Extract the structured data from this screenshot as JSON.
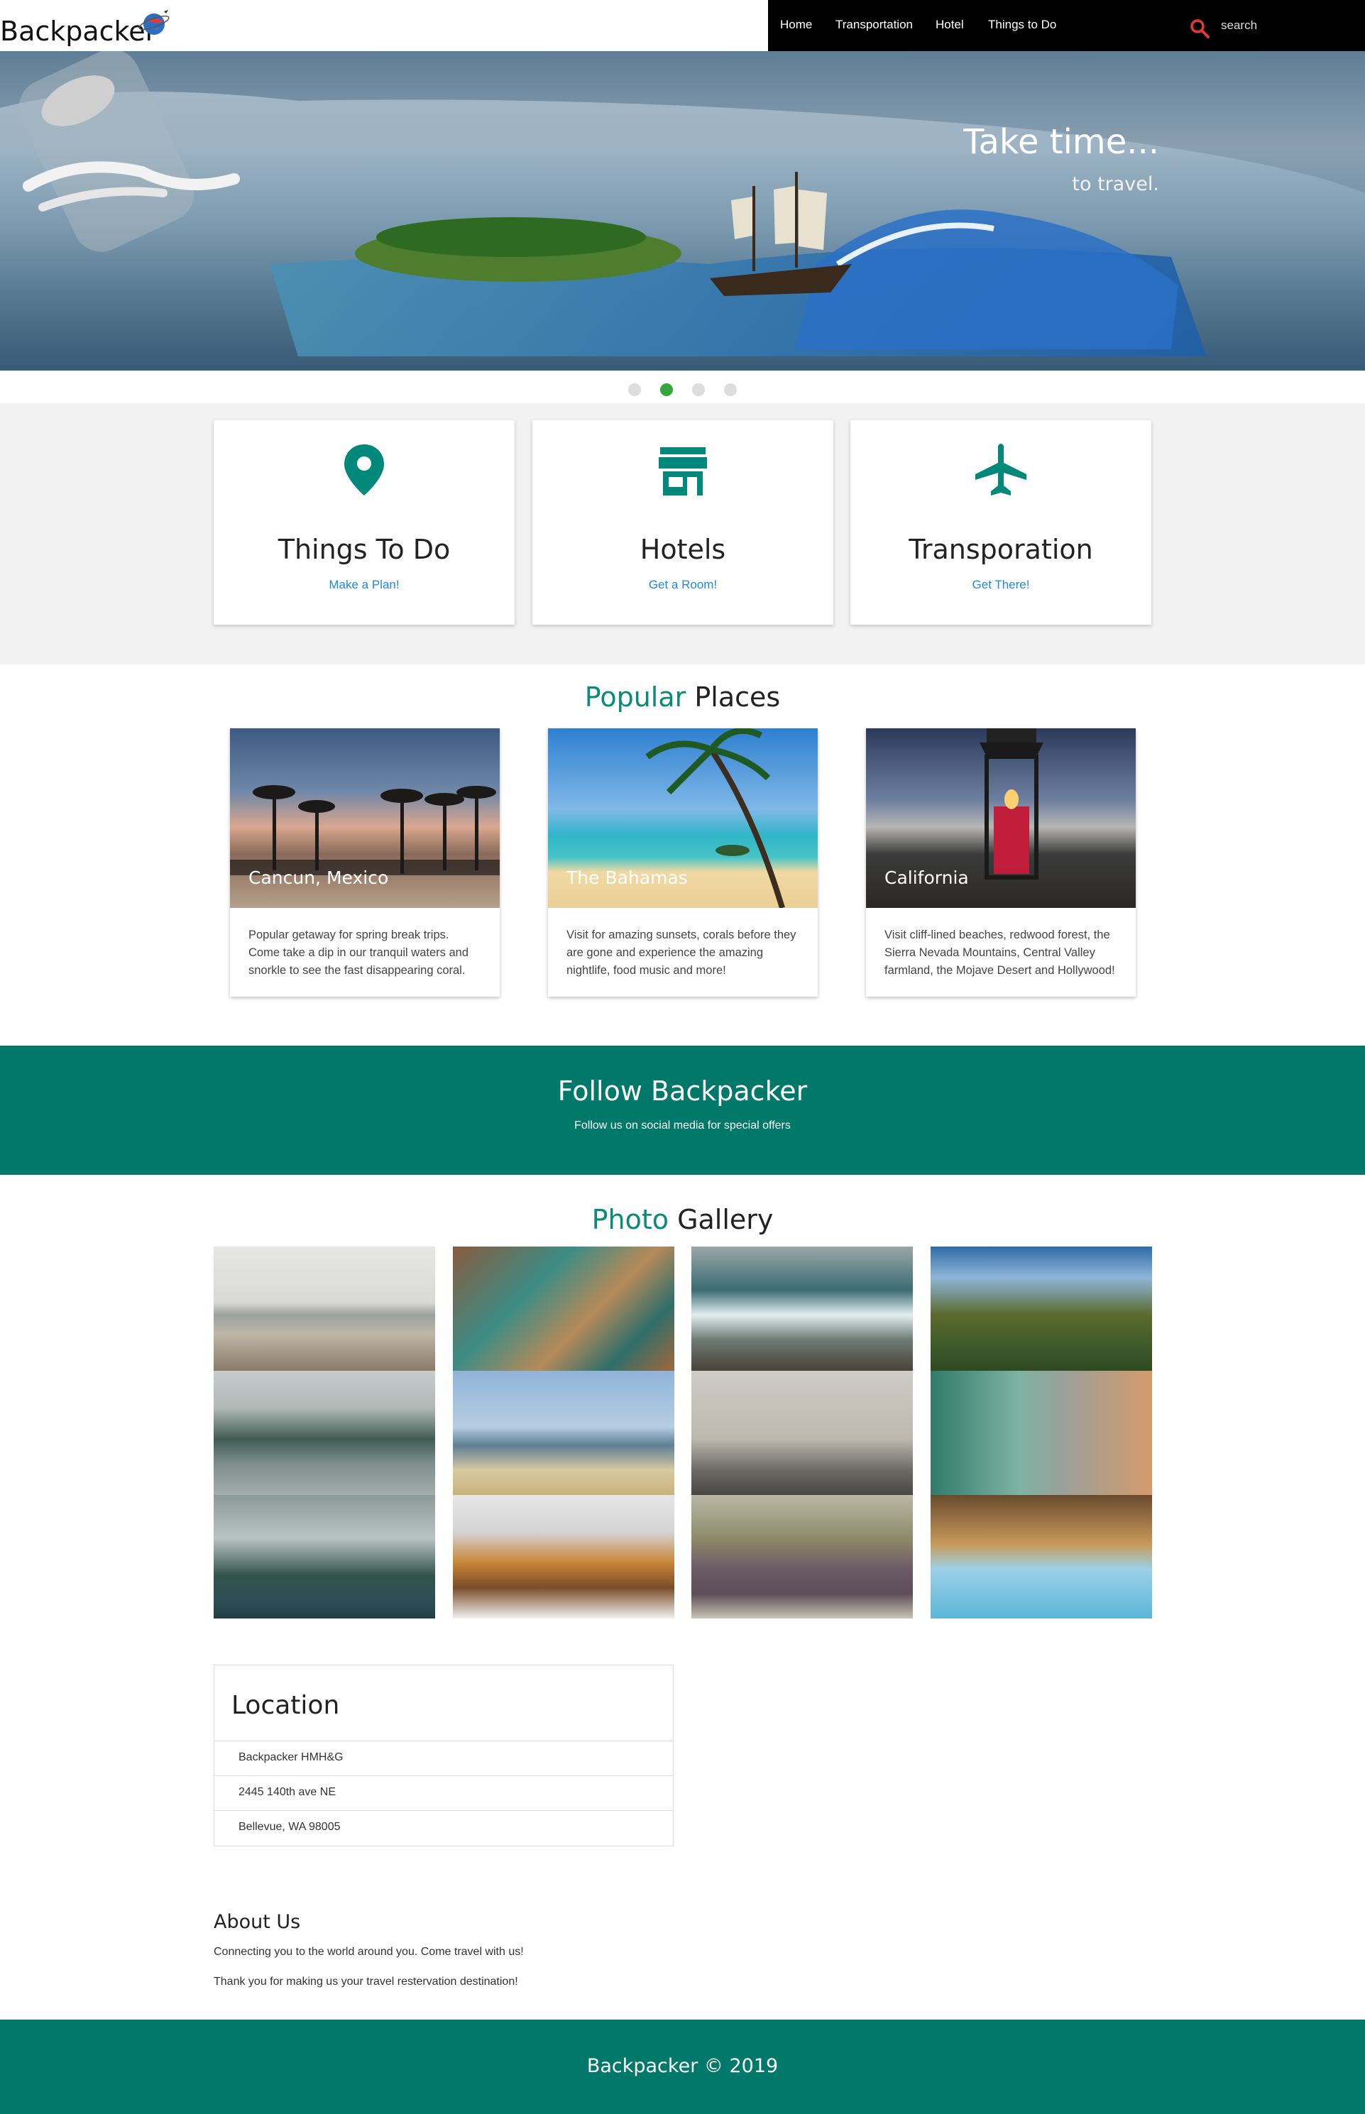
{
  "header": {
    "brand": "Backpacker",
    "nav": [
      "Home",
      "Transportation",
      "Hotel",
      "Things to Do"
    ],
    "search_placeholder": "search"
  },
  "hero": {
    "title": "Take time...",
    "subtitle": "to travel.",
    "slide_count": 4,
    "active_slide": 2
  },
  "services": [
    {
      "icon": "map-pin-icon",
      "title": "Things To Do",
      "link": "Make a Plan!"
    },
    {
      "icon": "store-icon",
      "title": "Hotels",
      "link": "Get a Room!"
    },
    {
      "icon": "airplane-icon",
      "title": "Transporation",
      "link": "Get There!"
    }
  ],
  "popular": {
    "title_accent": "Popular",
    "title_rest": " Places",
    "places": [
      {
        "name": "Cancun, Mexico",
        "desc": "Popular getaway for spring break trips. Come take a dip in our tranquil waters and snorkle to see the fast disappearing coral."
      },
      {
        "name": "The Bahamas",
        "desc": "Visit for amazing sunsets, corals before they are gone and experience the amazing nightlife, food music and more!"
      },
      {
        "name": "California",
        "desc": "Visit cliff-lined beaches, redwood forest, the Sierra Nevada Mountains, Central Valley farmland, the Mojave Desert and Hollywood!"
      }
    ]
  },
  "follow": {
    "title": "Follow Backpacker",
    "subtitle": "Follow us on social media for special offers"
  },
  "gallery": {
    "title_accent": "Photo",
    "title_rest": " Gallery"
  },
  "location": {
    "title": "Location",
    "lines": [
      "Backpacker HMH&G",
      "2445 140th ave NE",
      "Bellevue, WA 98005"
    ]
  },
  "about": {
    "title": "About Us",
    "lines": [
      "Connecting you to the world around you. Come travel with us!",
      "Thank you for making us your travel restervation destination!"
    ]
  },
  "footer": {
    "text": "Backpacker © 2019"
  },
  "colors": {
    "accent": "#00786a",
    "accent_text": "#0b8a77",
    "link": "#1e88e5",
    "search_icon": "#e53935",
    "active_dot": "#35a63c"
  }
}
